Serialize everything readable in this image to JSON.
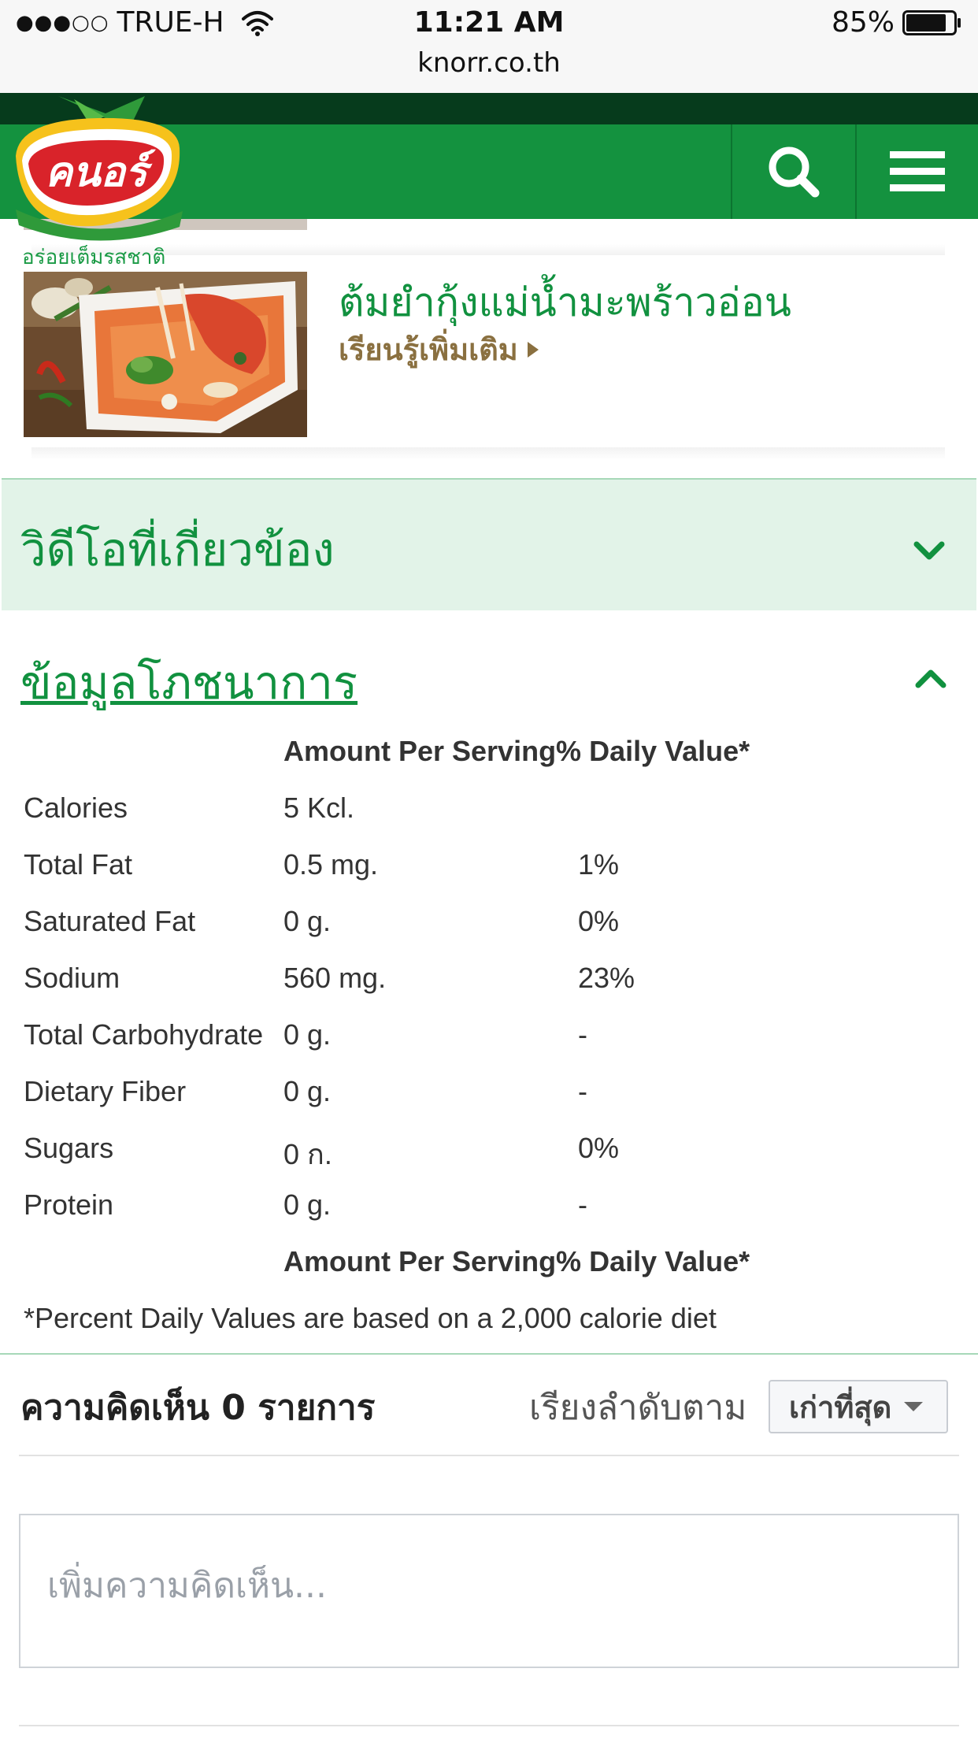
{
  "status_bar": {
    "signal": "●●●○○",
    "carrier": "TRUE-H",
    "time": "11:21 AM",
    "url": "knorr.co.th",
    "battery": "85%",
    "battery_level": 0.85
  },
  "header": {
    "logo_text": "คนอร์",
    "tagline": "อร่อยเต็มรสชาติ",
    "icons": [
      "search-icon",
      "hamburger-menu-icon"
    ],
    "colors": {
      "bar": "#14923f",
      "strip": "#063b1c",
      "logo_red": "#d9232a",
      "logo_yellow": "#f6c21c"
    }
  },
  "recipe": {
    "title": "ต้มยำกุ้งแม่น้ำมะพร้าวอ่อน",
    "more_link": "เรียนรู้เพิ่มเติม"
  },
  "video_section": {
    "title": "วิดีโอที่เกี่ยวข้อง",
    "expanded": false
  },
  "nutrition": {
    "title": "ข้อมูลโภชนาการ",
    "expanded": true,
    "header": "Amount Per Serving% Daily Value*",
    "rows": [
      {
        "name": "Calories",
        "amount": "5 Kcl.",
        "daily": ""
      },
      {
        "name": "Total Fat",
        "amount": "0.5 mg.",
        "daily": "1%"
      },
      {
        "name": "Saturated Fat",
        "amount": "0 g.",
        "daily": "0%"
      },
      {
        "name": "Sodium",
        "amount": "560 mg.",
        "daily": "23%"
      },
      {
        "name": "Total Carbohydrate",
        "amount": "0 g.",
        "daily": "-"
      },
      {
        "name": "Dietary Fiber",
        "amount": "0 g.",
        "daily": "-"
      },
      {
        "name": "Sugars",
        "amount": "0 ก.",
        "daily": "0%"
      },
      {
        "name": "Protein",
        "amount": "0 g.",
        "daily": "-"
      }
    ],
    "footer_header": "Amount Per Serving% Daily Value*",
    "footnote": "*Percent Daily Values are based on a 2,000 calorie diet"
  },
  "comments": {
    "count_label": "ความคิดเห็น 0 รายการ",
    "sort_label": "เรียงลำดับตาม",
    "sort_value": "เก่าที่สุด",
    "placeholder": "เพิ่มความคิดเห็น..."
  },
  "accent_color": "#11913f"
}
